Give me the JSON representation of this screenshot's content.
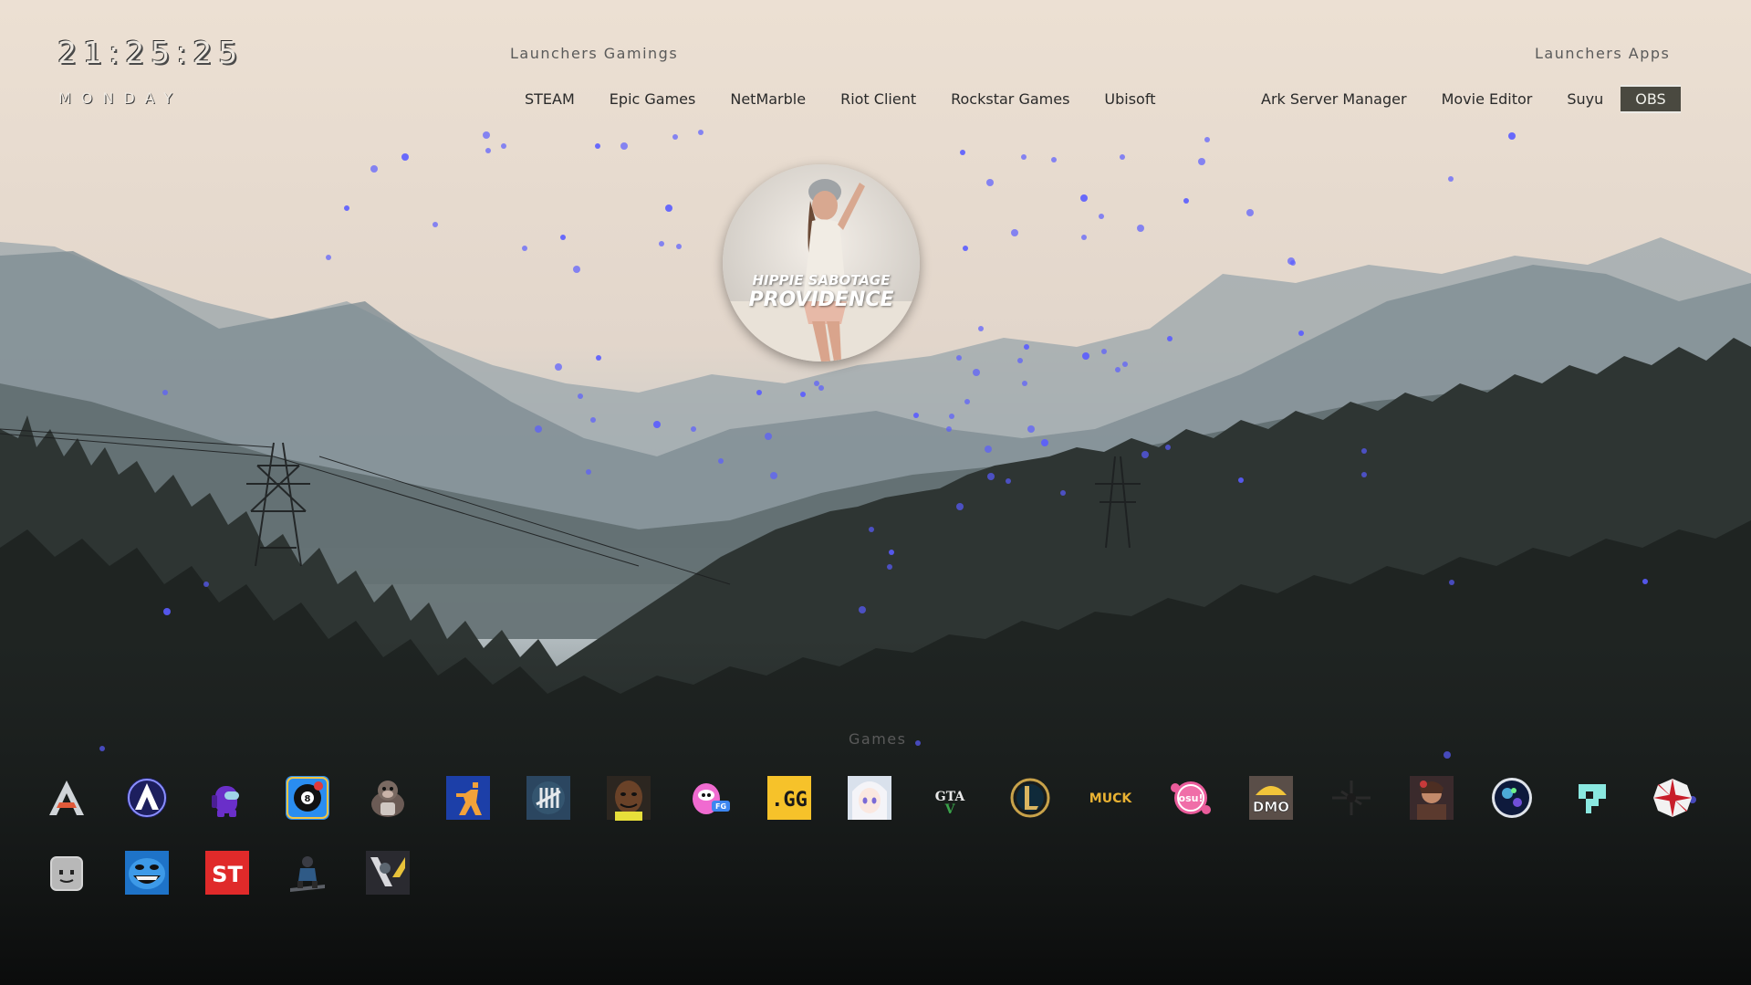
{
  "clock": {
    "time": "21:25:25",
    "weekday": "MONDAY"
  },
  "launchers_gaming": {
    "title": "Launchers Gamings",
    "items": [
      "STEAM",
      "Epic Games",
      "NetMarble",
      "Riot Client",
      "Rockstar Games",
      "Ubisoft"
    ]
  },
  "launchers_apps": {
    "title": "Launchers Apps",
    "items": [
      "Ark Server Manager",
      "Movie Editor",
      "Suyu",
      "OBS"
    ],
    "active_item": "OBS"
  },
  "now_playing": {
    "artist": "HIPPIE SABOTAGE",
    "track": "PROVIDENCE"
  },
  "games": {
    "title": "Games",
    "icons": [
      "ark-icon",
      "apex-icon",
      "among-us-icon",
      "8-ball-pool-icon",
      "gorilla-icon",
      "counter-strike-icon",
      "dead-by-daylight-icon",
      "meme-face-icon",
      "fall-guys-icon",
      "gg-icon",
      "anime-girl-icon",
      "gta-v-icon",
      "league-of-legends-icon",
      "muck-icon",
      "osu-icon",
      "dmo-icon",
      "dark-logo-icon",
      "hero-portrait-icon",
      "space-orb-icon",
      "pixel-creature-icon",
      "umbrella-icon",
      "roblox-face-icon",
      "grinning-mask-icon",
      "st-icon",
      "rider-icon",
      "valorant-icon"
    ],
    "muck_text": "MUCK",
    "st_text": "ST",
    "gg_text": ".GG",
    "dmo_text": "DMO",
    "osu_text": "osu!"
  },
  "colors": {
    "particle": "#5a5cff",
    "active_bg": "#4a4940",
    "sky": "#ece0d3"
  }
}
